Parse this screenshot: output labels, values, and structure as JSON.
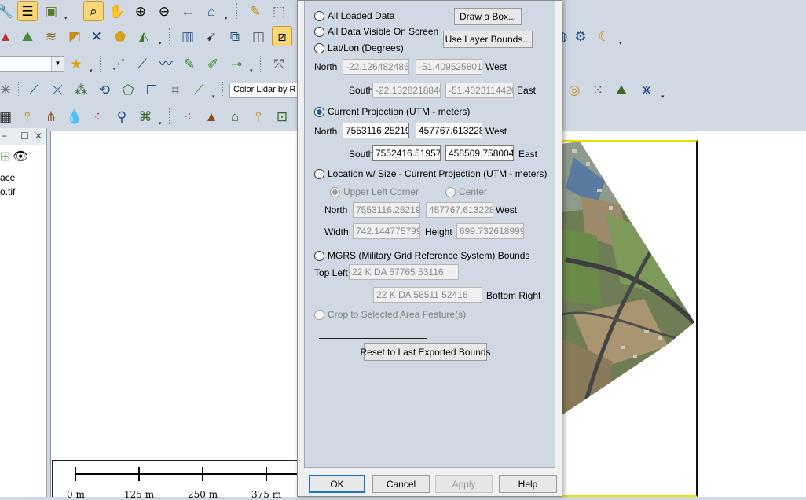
{
  "toolbar": {
    "combo_layer_value": "",
    "combo_color_value": "Color Lidar by R",
    "icons": [
      "cursor-icon",
      "layers-icon",
      "frame-icon",
      "zoom-select-icon",
      "pan-hand-icon",
      "zoom-in-icon",
      "zoom-out-icon",
      "back-arrow-icon",
      "home-icon",
      "pencil-icon",
      "select-box-icon",
      "star-icon",
      "eye-icon"
    ]
  },
  "left_panel": {
    "items": [
      "ace",
      "o.tif"
    ]
  },
  "scalebar": {
    "labels": [
      "0 m",
      "125 m",
      "250 m",
      "375 m"
    ]
  },
  "dialog": {
    "options": {
      "all_loaded": "All Loaded Data",
      "all_visible": "All Data Visible On Screen",
      "latlon": "Lat/Lon (Degrees)",
      "current_proj": "Current Projection (UTM - meters)",
      "location_size": "Location w/ Size - Current Projection (UTM - meters)",
      "upper_left": "Upper Left Corner",
      "center": "Center",
      "mgrs": "MGRS (Military Grid Reference System) Bounds",
      "crop": "Crop to Selected Area Feature(s)"
    },
    "selected_option": "current_proj",
    "labels": {
      "north": "North",
      "south": "South",
      "west": "West",
      "east": "East",
      "width": "Width",
      "height": "Height",
      "top_left": "Top Left",
      "bottom_right": "Bottom Right"
    },
    "latlon": {
      "north": "-22.12648248683",
      "west": "-51.40952580159",
      "south": "-22.13282188463",
      "east": "-51.40231144200"
    },
    "utm": {
      "north": "7553116.252195",
      "west": "457767.6132288",
      "south": "7552416.519576",
      "east": "458509.7580046"
    },
    "location": {
      "north": "7553116.252195",
      "west": "457767.6132288",
      "width": "742.1447757999",
      "height": "699.7326189996"
    },
    "mgrs": {
      "top_left": "22 K DA 57765 53116",
      "bottom_right": "22 K DA 58511 52416"
    },
    "buttons": {
      "draw_box": "Draw a Box...",
      "use_layer_bounds": "Use Layer Bounds...",
      "reset_bounds": "Reset to Last Exported Bounds",
      "ok": "OK",
      "cancel": "Cancel",
      "apply": "Apply",
      "help": "Help"
    }
  }
}
